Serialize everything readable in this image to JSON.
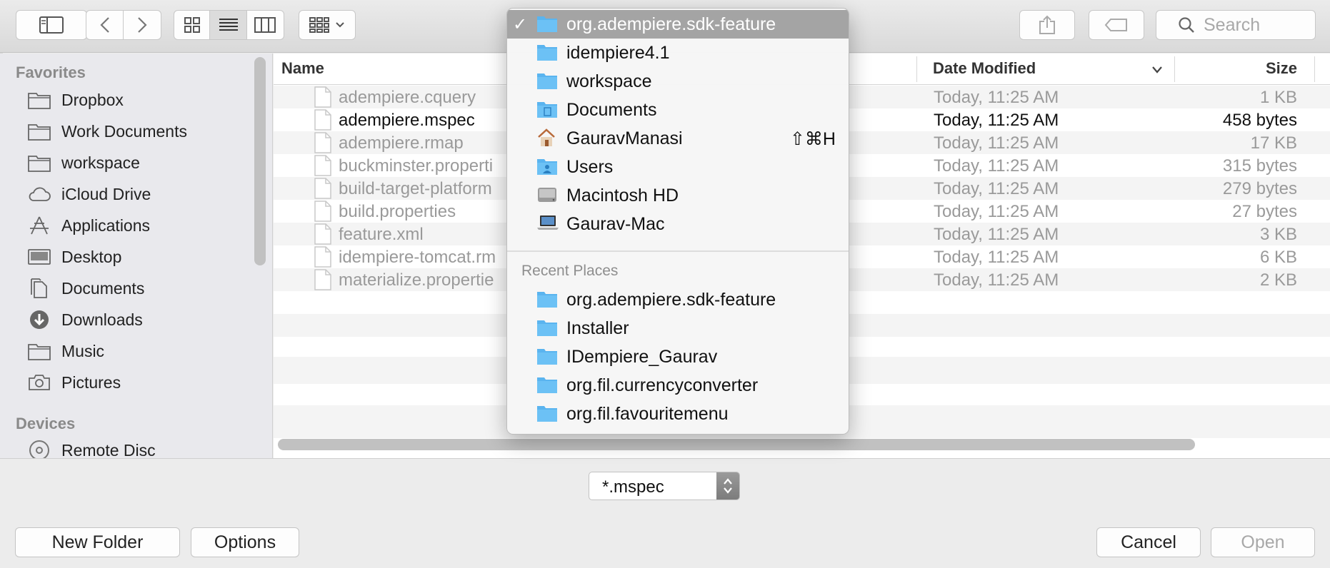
{
  "toolbar": {
    "search_placeholder": "Search"
  },
  "sidebar": {
    "favorites_heading": "Favorites",
    "favorites": [
      {
        "label": "Dropbox",
        "icon": "folder-icon"
      },
      {
        "label": "Work Documents",
        "icon": "folder-icon"
      },
      {
        "label": "workspace",
        "icon": "folder-icon"
      },
      {
        "label": "iCloud Drive",
        "icon": "cloud-icon"
      },
      {
        "label": "Applications",
        "icon": "applications-icon"
      },
      {
        "label": "Desktop",
        "icon": "desktop-icon"
      },
      {
        "label": "Documents",
        "icon": "documents-icon"
      },
      {
        "label": "Downloads",
        "icon": "downloads-icon"
      },
      {
        "label": "Music",
        "icon": "folder-icon"
      },
      {
        "label": "Pictures",
        "icon": "camera-icon"
      }
    ],
    "devices_heading": "Devices",
    "devices": [
      {
        "label": "Remote Disc",
        "icon": "disc-icon"
      }
    ]
  },
  "filelist": {
    "columns": {
      "name": "Name",
      "date": "Date Modified",
      "size": "Size"
    },
    "rows": [
      {
        "name": "adempiere.cquery",
        "date": "Today, 11:25 AM",
        "size": "1 KB",
        "enabled": false
      },
      {
        "name": "adempiere.mspec",
        "date": "Today, 11:25 AM",
        "size": "458 bytes",
        "enabled": true
      },
      {
        "name": "adempiere.rmap",
        "date": "Today, 11:25 AM",
        "size": "17 KB",
        "enabled": false
      },
      {
        "name": "buckminster.properti",
        "date": "Today, 11:25 AM",
        "size": "315 bytes",
        "enabled": false
      },
      {
        "name": "build-target-platform",
        "date": "Today, 11:25 AM",
        "size": "279 bytes",
        "enabled": false
      },
      {
        "name": "build.properties",
        "date": "Today, 11:25 AM",
        "size": "27 bytes",
        "enabled": false
      },
      {
        "name": "feature.xml",
        "date": "Today, 11:25 AM",
        "size": "3 KB",
        "enabled": false
      },
      {
        "name": "idempiere-tomcat.rm",
        "date": "Today, 11:25 AM",
        "size": "6 KB",
        "enabled": false
      },
      {
        "name": "materialize.propertie",
        "date": "Today, 11:25 AM",
        "size": "2 KB",
        "enabled": false
      }
    ]
  },
  "dropdown": {
    "path_items": [
      {
        "label": "org.adempiere.sdk-feature",
        "icon": "folder-icon",
        "selected": true,
        "check": "✓"
      },
      {
        "label": "idempiere4.1",
        "icon": "folder-icon"
      },
      {
        "label": "workspace",
        "icon": "folder-icon"
      },
      {
        "label": "Documents",
        "icon": "documents-folder-icon"
      },
      {
        "label": "GauravManasi",
        "icon": "home-icon",
        "shortcut": "⇧⌘H"
      },
      {
        "label": "Users",
        "icon": "users-folder-icon"
      },
      {
        "label": "Macintosh HD",
        "icon": "hard-drive-icon"
      },
      {
        "label": "Gaurav-Mac",
        "icon": "laptop-icon"
      }
    ],
    "recent_heading": "Recent Places",
    "recent_items": [
      {
        "label": "org.adempiere.sdk-feature",
        "icon": "folder-icon"
      },
      {
        "label": "Installer",
        "icon": "folder-icon"
      },
      {
        "label": "IDempiere_Gaurav",
        "icon": "folder-icon"
      },
      {
        "label": "org.fil.currencyconverter",
        "icon": "folder-icon"
      },
      {
        "label": "org.fil.favouritemenu",
        "icon": "folder-icon"
      }
    ]
  },
  "bottom": {
    "filter_value": "*.mspec",
    "new_folder_label": "New Folder",
    "options_label": "Options",
    "cancel_label": "Cancel",
    "open_label": "Open"
  },
  "colors": {
    "folder_blue": "#5ab4ef",
    "selected_row": "#a4a4a4",
    "disabled_text": "#9a9a9a"
  }
}
